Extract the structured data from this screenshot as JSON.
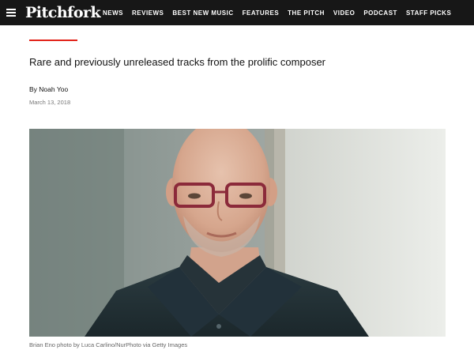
{
  "header": {
    "menu_icon": "hamburger-menu-icon",
    "logo_text": "Pitchfork",
    "nav_items": [
      "NEWS",
      "REVIEWS",
      "BEST NEW MUSIC",
      "FEATURES",
      "THE PITCH",
      "VIDEO",
      "PODCAST",
      "STAFF PICKS"
    ]
  },
  "article": {
    "dek": "Rare and previously unreleased tracks from the prolific composer",
    "byline_prefix": "By",
    "author": "Noah Yoo",
    "date": "March 13, 2018",
    "photo_caption": "Brian Eno photo by Luca Carlino/NurPhoto via Getty Images"
  },
  "colors": {
    "topbar": "#171717",
    "accent_rule": "#e2231a"
  }
}
